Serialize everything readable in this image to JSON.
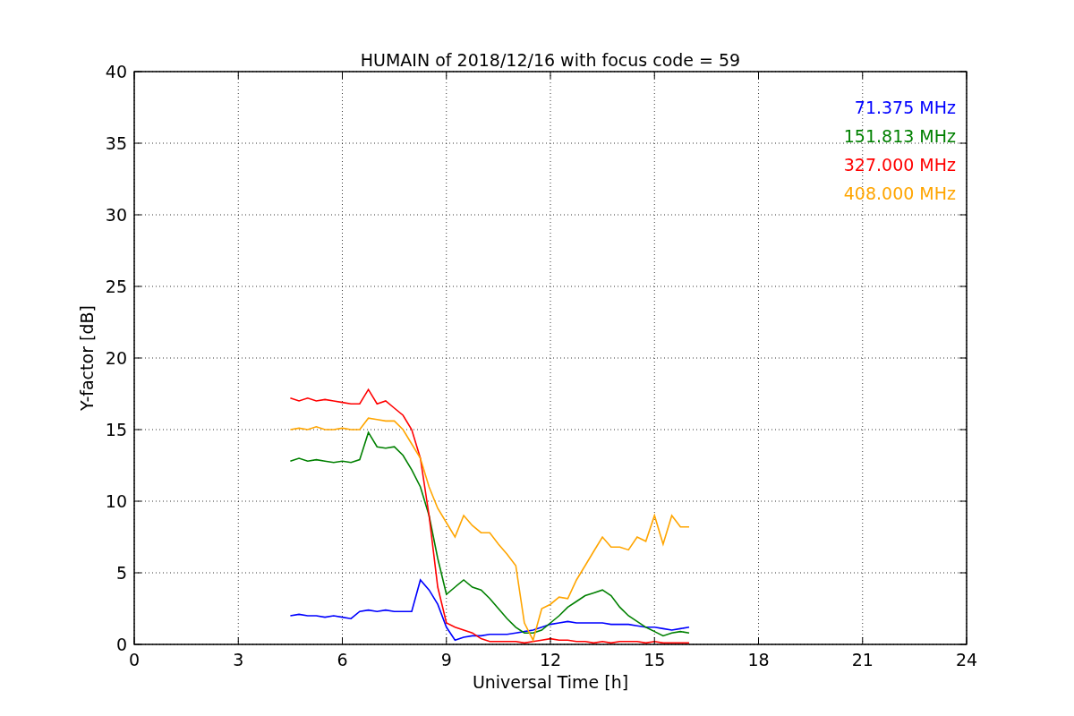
{
  "figure": {
    "chart_data": {
      "type": "line",
      "title": "HUMAIN of 2018/12/16 with focus code = 59",
      "xlabel": "Universal Time [h]",
      "ylabel": "Y-factor [dB]",
      "x": [
        4.5,
        4.75,
        5,
        5.25,
        5.5,
        5.75,
        6,
        6.25,
        6.5,
        6.75,
        7,
        7.25,
        7.5,
        7.75,
        8,
        8.25,
        8.5,
        8.75,
        9,
        9.25,
        9.5,
        9.75,
        10,
        10.25,
        10.5,
        10.75,
        11,
        11.25,
        11.5,
        11.75,
        12,
        12.25,
        12.5,
        12.75,
        13,
        13.25,
        13.5,
        13.75,
        14,
        14.25,
        14.5,
        14.75,
        15,
        15.25,
        15.5,
        15.75,
        16
      ],
      "series": [
        {
          "name": "71.375 MHz",
          "color": "#0000ff",
          "values": [
            2.0,
            2.1,
            2.0,
            2.0,
            1.9,
            2.0,
            1.9,
            1.8,
            2.3,
            2.4,
            2.3,
            2.4,
            2.3,
            2.3,
            2.3,
            4.5,
            3.8,
            2.8,
            1.2,
            0.3,
            0.5,
            0.6,
            0.6,
            0.7,
            0.7,
            0.7,
            0.8,
            0.9,
            1.0,
            1.2,
            1.4,
            1.5,
            1.6,
            1.5,
            1.5,
            1.5,
            1.5,
            1.4,
            1.4,
            1.4,
            1.3,
            1.2,
            1.2,
            1.1,
            1.0,
            1.1,
            1.2
          ]
        },
        {
          "name": "151.813 MHz",
          "color": "#008000",
          "values": [
            12.8,
            13.0,
            12.8,
            12.9,
            12.8,
            12.7,
            12.8,
            12.7,
            12.9,
            14.8,
            13.8,
            13.7,
            13.8,
            13.2,
            12.2,
            11.0,
            9.0,
            6.0,
            3.5,
            4.0,
            4.5,
            4.0,
            3.8,
            3.2,
            2.5,
            1.8,
            1.2,
            0.8,
            0.8,
            1.0,
            1.5,
            2.0,
            2.6,
            3.0,
            3.4,
            3.6,
            3.8,
            3.4,
            2.6,
            2.0,
            1.6,
            1.2,
            0.9,
            0.6,
            0.8,
            0.9,
            0.8
          ]
        },
        {
          "name": "327.000 MHz",
          "color": "#ff0000",
          "values": [
            17.2,
            17.0,
            17.2,
            17.0,
            17.1,
            17.0,
            16.9,
            16.8,
            16.8,
            17.8,
            16.8,
            17.0,
            16.5,
            16.0,
            15.0,
            13.0,
            9.0,
            4.0,
            1.5,
            1.2,
            1.0,
            0.8,
            0.4,
            0.2,
            0.2,
            0.2,
            0.2,
            0.1,
            0.2,
            0.3,
            0.4,
            0.3,
            0.3,
            0.2,
            0.2,
            0.1,
            0.2,
            0.1,
            0.2,
            0.2,
            0.2,
            0.1,
            0.2,
            0.1,
            0.1,
            0.1,
            0.1
          ]
        },
        {
          "name": "408.000 MHz",
          "color": "#ffa500",
          "values": [
            15.0,
            15.1,
            15.0,
            15.2,
            15.0,
            15.0,
            15.1,
            15.0,
            15.0,
            15.8,
            15.7,
            15.6,
            15.6,
            15.0,
            14.0,
            13.0,
            11.0,
            9.5,
            8.5,
            7.5,
            9.0,
            8.3,
            7.8,
            7.8,
            7.0,
            6.3,
            5.5,
            1.5,
            0.3,
            2.5,
            2.8,
            3.3,
            3.2,
            4.5,
            5.5,
            6.5,
            7.5,
            6.8,
            6.8,
            6.6,
            7.5,
            7.2,
            9.0,
            7.0,
            9.0,
            8.2,
            8.2
          ]
        }
      ],
      "grid": true,
      "xlim": [
        0,
        24
      ],
      "ylim": [
        0,
        40
      ],
      "xticks": [
        0,
        3,
        6,
        9,
        12,
        15,
        18,
        21,
        24
      ],
      "yticks": [
        0,
        5,
        10,
        15,
        20,
        25,
        30,
        35,
        40
      ]
    }
  }
}
